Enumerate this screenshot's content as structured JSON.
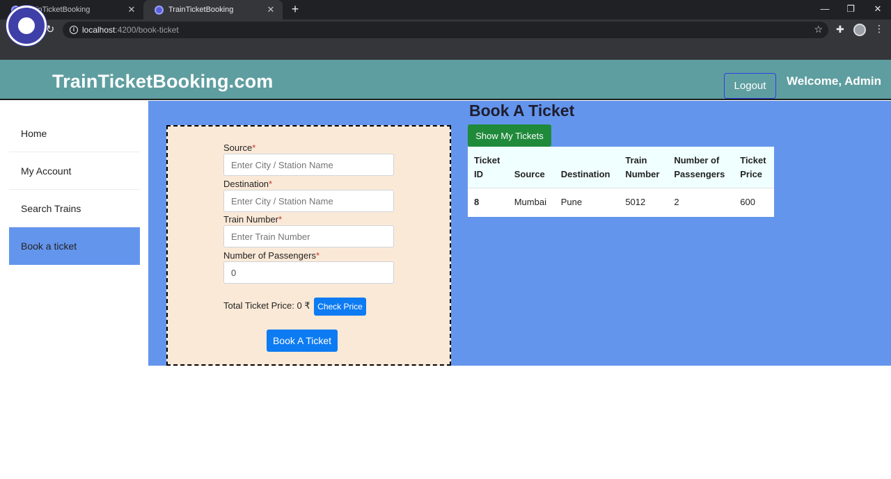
{
  "browser": {
    "tabs": [
      {
        "title": "TrainTicketBooking",
        "active": false
      },
      {
        "title": "TrainTicketBooking",
        "active": true
      }
    ],
    "url_host": "localhost",
    "url_path": ":4200/book-ticket"
  },
  "header": {
    "brand": "TrainTicketBooking.com",
    "logout_label": "Logout",
    "welcome": "Welcome, Admin"
  },
  "sidebar": {
    "items": [
      {
        "label": "Home",
        "active": false
      },
      {
        "label": "My Account",
        "active": false
      },
      {
        "label": "Search Trains",
        "active": false
      },
      {
        "label": "Book a ticket",
        "active": true
      }
    ]
  },
  "form": {
    "source_label": "Source",
    "source_placeholder": "Enter City / Station Name",
    "destination_label": "Destination",
    "destination_placeholder": "Enter City / Station Name",
    "train_label": "Train Number",
    "train_placeholder": "Enter Train Number",
    "passengers_label": "Number of Passengers",
    "passengers_value": "0",
    "required_mark": "*",
    "price_text": "Total Ticket Price: 0 ₹",
    "check_price_label": "Check Price",
    "book_label": "Book A Ticket"
  },
  "main": {
    "title": "Book A Ticket",
    "show_tickets_label": "Show My Tickets"
  },
  "tickets_table": {
    "headers": [
      {
        "line1": "Ticket",
        "line2": "ID"
      },
      {
        "line1": "",
        "line2": "Source"
      },
      {
        "line1": "",
        "line2": "Destination"
      },
      {
        "line1": "Train",
        "line2": "Number"
      },
      {
        "line1": "Number of",
        "line2": "Passengers"
      },
      {
        "line1": "Ticket",
        "line2": "Price"
      }
    ],
    "rows": [
      {
        "ticket_id": "8",
        "source": "Mumbai",
        "destination": "Pune",
        "train_number": "5012",
        "passengers": "2",
        "price": "600"
      }
    ]
  },
  "colors": {
    "header_bg": "#5f9ea0",
    "main_bg": "#6495ed",
    "form_bg": "#fbe9d7",
    "primary_button": "#0d7bf2",
    "success_button": "#1f8a3a",
    "table_header_bg": "#f0ffff"
  }
}
